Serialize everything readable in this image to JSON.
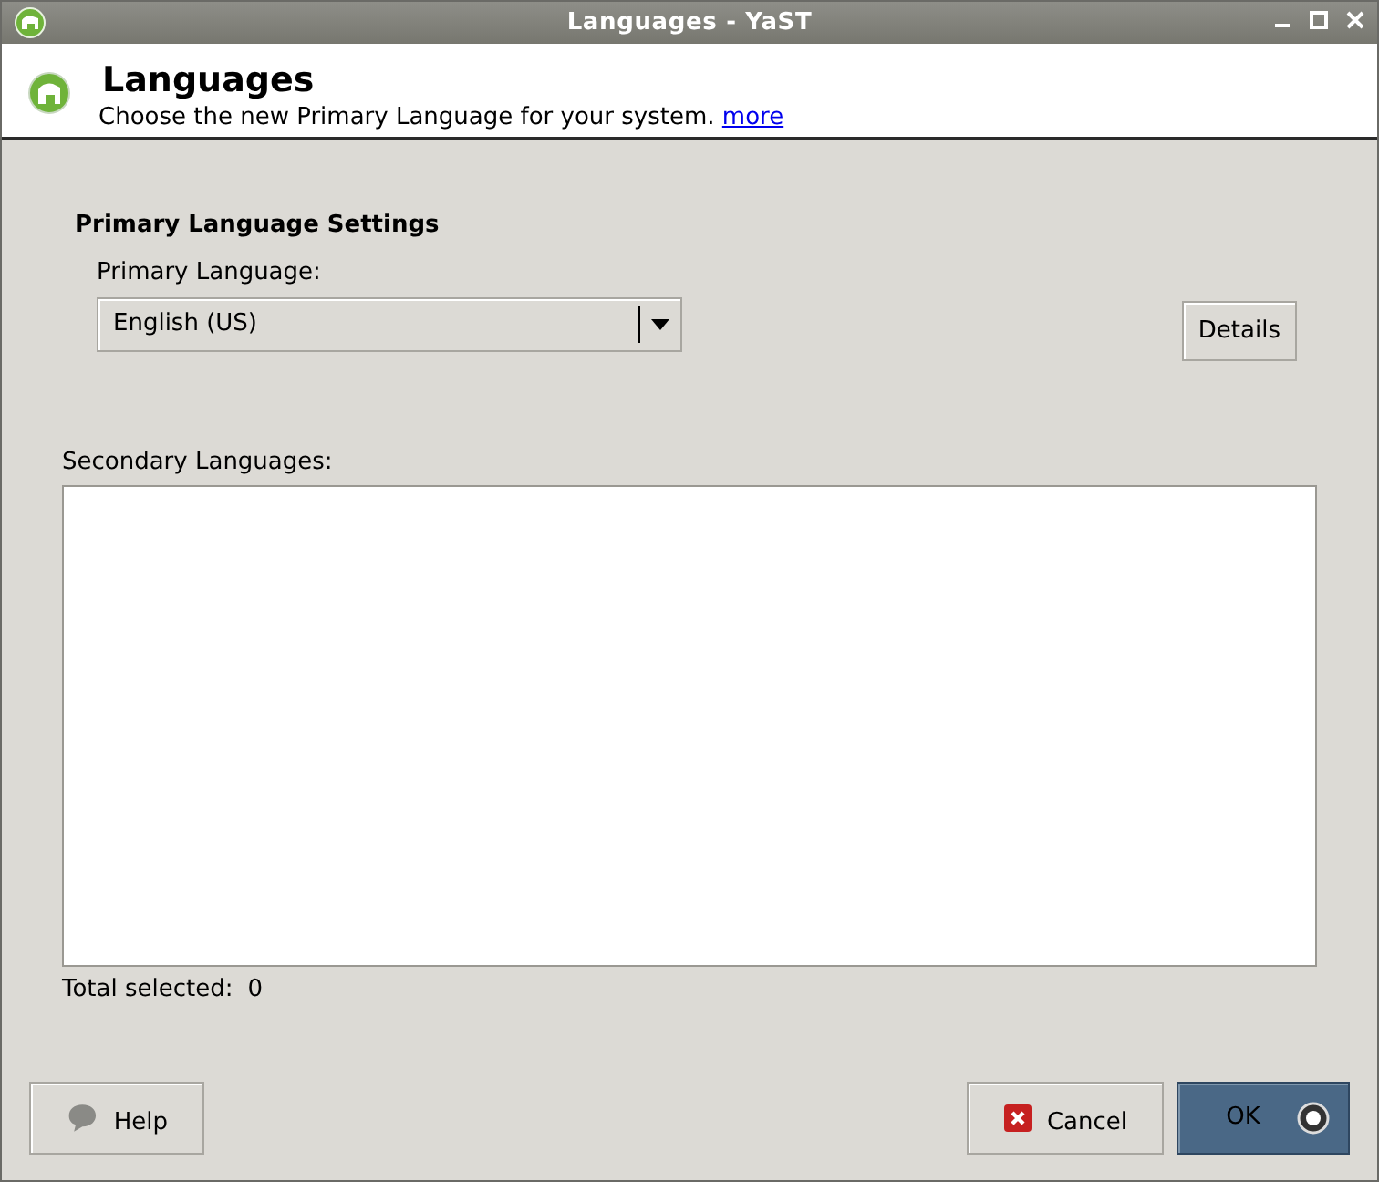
{
  "window": {
    "title": "Languages - YaST"
  },
  "header": {
    "title": "Languages",
    "description": "Choose the new Primary Language for your system.",
    "link": "more"
  },
  "primary": {
    "heading": "Primary Language Settings",
    "label": "Primary Language:",
    "value": "English (US)",
    "details_button": "Details"
  },
  "secondary": {
    "label": "Secondary Languages:",
    "total_label": "Total selected:",
    "total": "0"
  },
  "buttons": [
    {
      "label": "Help",
      "kind": "help",
      "default": false
    },
    {
      "label": "Cancel",
      "kind": "cancel",
      "default": false
    },
    {
      "label": "OK",
      "kind": "ok",
      "default": true
    }
  ]
}
